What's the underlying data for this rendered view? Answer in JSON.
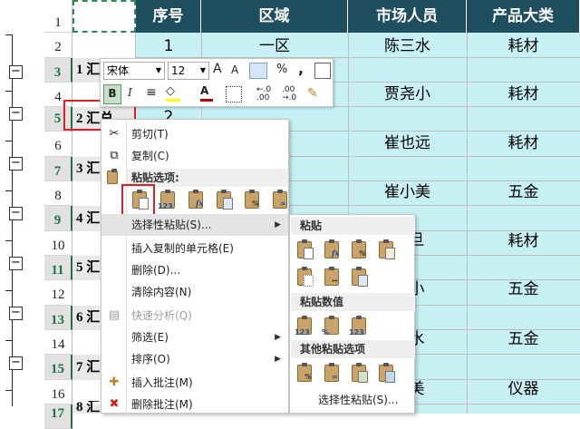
{
  "headers": {
    "row1": "1",
    "col_seq": "序号",
    "col_region": "区域",
    "col_staff": "市场人员",
    "col_category": "产品大类"
  },
  "rows": [
    {
      "rownum": "2",
      "seq": "1",
      "region": "一区",
      "staff": "陈三水",
      "cat": "耗材"
    },
    {
      "rownum": "3",
      "label": "1 汇"
    },
    {
      "rownum": "4",
      "seq": "",
      "region": "",
      "staff": "贾尧小",
      "cat": "耗材"
    },
    {
      "rownum": "5",
      "label": "2 汇总",
      "seq": "2"
    },
    {
      "rownum": "6",
      "staff": "崔也远",
      "cat": "耗材"
    },
    {
      "rownum": "7",
      "label": "3 汇"
    },
    {
      "rownum": "8",
      "staff": "崔小美",
      "cat": "五金"
    },
    {
      "rownum": "9",
      "label": "4 汇"
    },
    {
      "rownum": "10",
      "staff": "旦",
      "cat": "耗材"
    },
    {
      "rownum": "11",
      "label": "5 汇"
    },
    {
      "rownum": "12",
      "staff": "小",
      "cat": "五金"
    },
    {
      "rownum": "13",
      "label": "6 汇"
    },
    {
      "rownum": "14",
      "staff": "水",
      "cat": "五金"
    },
    {
      "rownum": "15",
      "label": "7 汇"
    },
    {
      "rownum": "16",
      "staff": "美",
      "cat": "仪器"
    },
    {
      "rownum": "17",
      "label": "8 汇"
    }
  ],
  "minibar": {
    "font": "宋体",
    "size": "12",
    "grow": "A",
    "shrink": "A",
    "percent": "%",
    "comma": ",",
    "bold": "B",
    "italic": "I",
    "font_color": "A",
    "inc_dec": "←.0 .00",
    "dec_dec": ".00 →.0"
  },
  "menu": {
    "cut": "剪切(T)",
    "copy": "复制(C)",
    "paste_options": "粘贴选项:",
    "paste_special": "选择性粘贴(S)...",
    "insert_copied": "插入复制的单元格(E)",
    "delete": "删除(D)...",
    "clear": "清除内容(N)",
    "quick_analysis": "快速分析(Q)",
    "filter": "筛选(E)",
    "sort": "排序(O)",
    "insert_comment": "插入批注(M)",
    "delete_comment": "删除批注(M)"
  },
  "submenu": {
    "paste": "粘贴",
    "paste_values": "粘贴数值",
    "other_paste": "其他粘贴选项",
    "paste_special": "选择性粘贴(S)..."
  },
  "colors": {
    "header_bg": "#1f4e5f",
    "cyan": "#c7f0f5",
    "highlight_red": "#e02020",
    "excel_green": "#217346"
  }
}
